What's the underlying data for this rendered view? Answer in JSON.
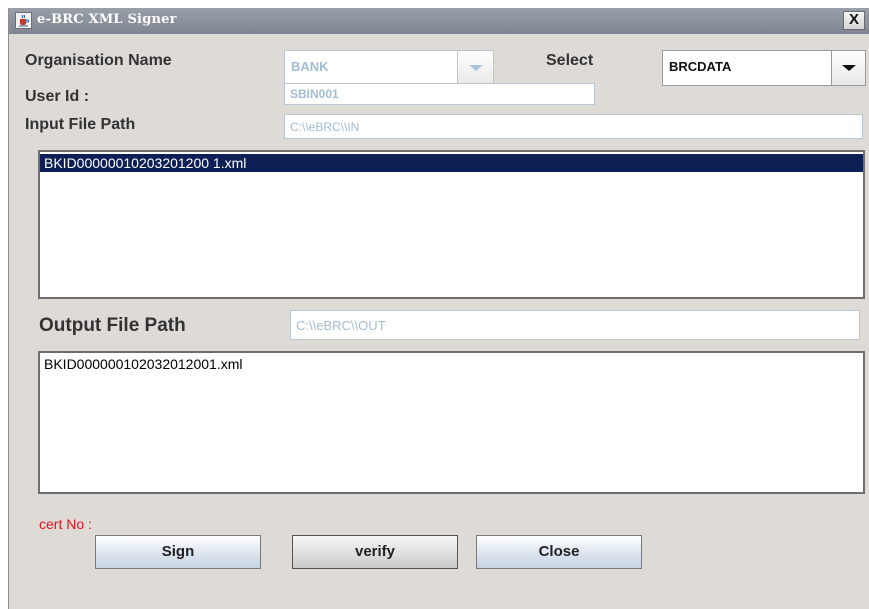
{
  "window": {
    "title": "e-BRC XML Signer",
    "close_glyph": "X"
  },
  "icons": {
    "app": "java-coffee-cup-icon",
    "close": "close-icon",
    "dropdown": "triangle-down-icon"
  },
  "colors": {
    "selection": "#0e1f56",
    "cert_label": "#e0141e",
    "disabled_text": "#a3bcd6",
    "window_bg": "#dedad5"
  },
  "form": {
    "org_label": "Organisation Name",
    "org_value": "BANK",
    "select_label": "Select",
    "select_value": "BRCDATA",
    "userid_label": "User Id :",
    "userid_value": "SBIN001",
    "input_path_label": "Input File Path",
    "input_path_value": "C:\\\\eBRC\\\\IN",
    "output_path_label": "Output File Path",
    "output_path_value": "C:\\\\eBRC\\\\OUT"
  },
  "input_files": [
    "BKID00000010203201200 1.xml"
  ],
  "output_files": [
    "BKID000000102032012001.xml"
  ],
  "cert_label": "cert No :",
  "buttons": {
    "sign": "Sign",
    "verify": "verify",
    "close": "Close"
  }
}
